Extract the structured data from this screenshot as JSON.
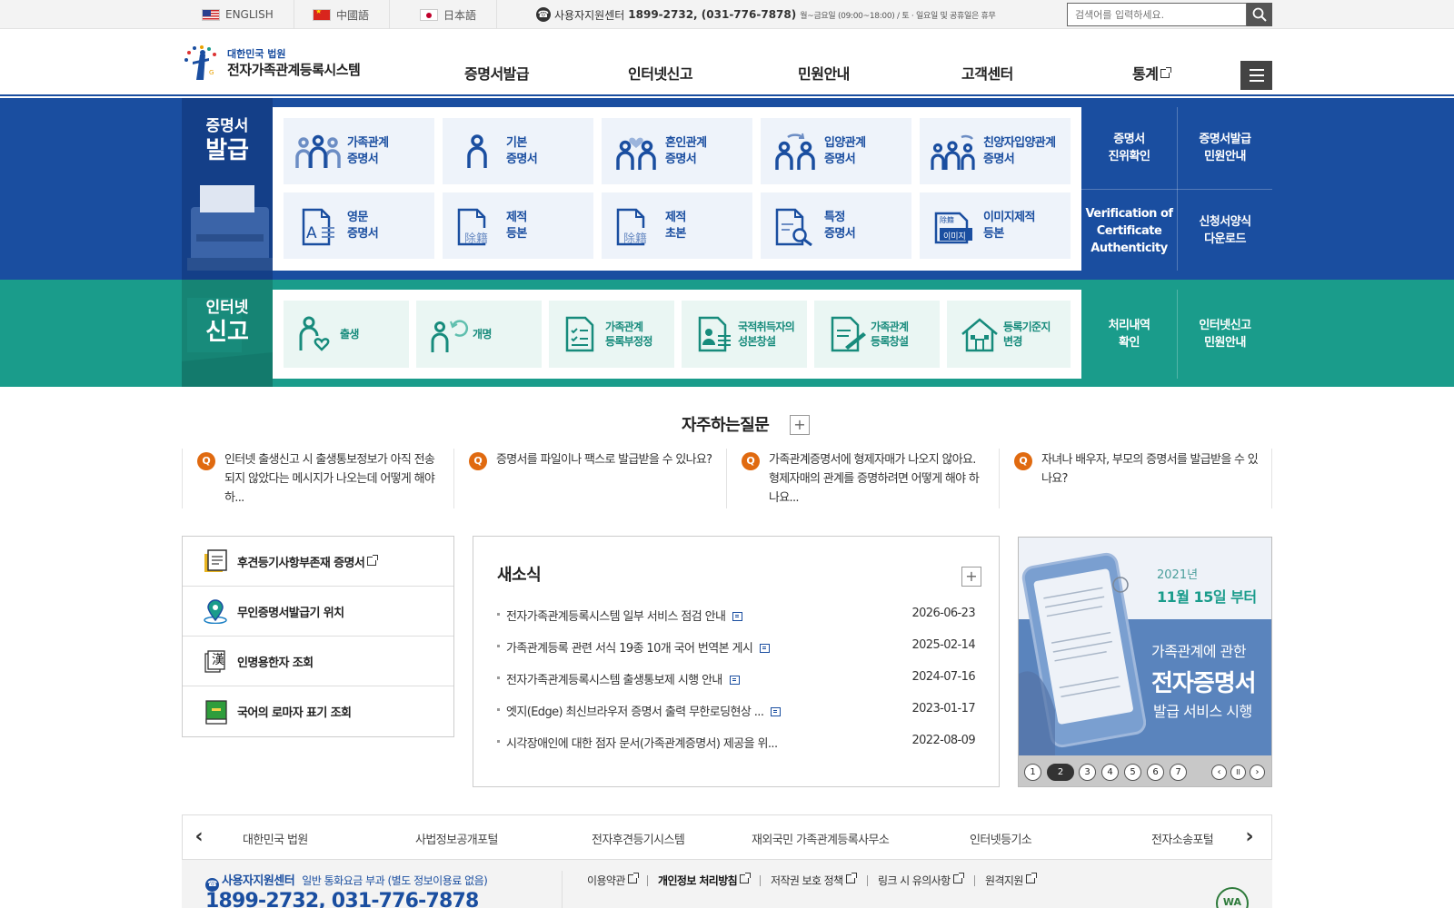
{
  "topbar": {
    "languages": [
      {
        "label": "ENGLISH",
        "flag": "us-flag-icon"
      },
      {
        "label": "中國語",
        "flag": "china-flag-icon"
      },
      {
        "label": "日本語",
        "flag": "japan-flag-icon"
      }
    ],
    "call_center_label": "사용자지원센터",
    "call_center_numbers": "1899-2732, (031-776-7878)",
    "call_center_hours": "월~금요일 (09:00~18:00) / 토 · 일요일 및 공휴일은 휴무",
    "search_placeholder": "검색어를 입력하세요."
  },
  "header": {
    "logo_org": "대한민국 법원",
    "logo_name": "전자가족관계등록시스템",
    "nav": [
      "증명서발급",
      "인터넷신고",
      "민원안내",
      "고객센터",
      "통계"
    ]
  },
  "certificates": {
    "title_small": "증명서",
    "title_big": "발급",
    "tiles": [
      {
        "line1": "가족관계",
        "line2": "증명서",
        "icon": "family-icon"
      },
      {
        "line1": "기본",
        "line2": "증명서",
        "icon": "person-icon"
      },
      {
        "line1": "혼인관계",
        "line2": "증명서",
        "icon": "marriage-icon"
      },
      {
        "line1": "입양관계",
        "line2": "증명서",
        "icon": "adoption-icon"
      },
      {
        "line1": "친양자입양관계",
        "line2": "증명서",
        "icon": "full-adoption-icon"
      },
      {
        "line1": "영문",
        "line2": "증명서",
        "icon": "english-document-icon"
      },
      {
        "line1": "제적",
        "line2": "등본",
        "icon": "removed-register-copy-icon",
        "badge": "除籍"
      },
      {
        "line1": "제적",
        "line2": "초본",
        "icon": "removed-register-abstract-icon",
        "badge": "除籍"
      },
      {
        "line1": "특정",
        "line2": "증명서",
        "icon": "document-search-icon"
      },
      {
        "line1": "이미지제적",
        "line2": "등본",
        "icon": "image-register-icon",
        "badge": "이미지",
        "badge_top": "除籍"
      }
    ],
    "side_links": [
      {
        "line1": "증명서",
        "line2": "진위확인"
      },
      {
        "line1": "증명서발급",
        "line2": "민원안내"
      },
      {
        "line1": "Verification of",
        "line2": "Certificate",
        "line3": "Authenticity"
      },
      {
        "line1": "신청서양식",
        "line2": "다운로드"
      }
    ]
  },
  "reports": {
    "title_small": "인터넷",
    "title_big": "신고",
    "tiles": [
      {
        "line1": "출생",
        "line2": "",
        "icon": "birth-icon"
      },
      {
        "line1": "개명",
        "line2": "",
        "icon": "rename-icon"
      },
      {
        "line1": "가족관계",
        "line2": "등록부정정",
        "icon": "register-correction-icon"
      },
      {
        "line1": "국적취득자의",
        "line2": "성본창설",
        "icon": "naturalization-icon"
      },
      {
        "line1": "가족관계",
        "line2": "등록창설",
        "icon": "register-creation-icon"
      },
      {
        "line1": "등록기준지",
        "line2": "변경",
        "icon": "house-icon"
      }
    ],
    "side_links": [
      {
        "line1": "처리내역",
        "line2": "확인"
      },
      {
        "line1": "인터넷신고",
        "line2": "민원안내"
      }
    ]
  },
  "faq": {
    "title": "자주하는질문",
    "more": "+",
    "badge": "Q",
    "items": [
      "인터넷 출생신고 시 출생통보정보가 아직 전송되지 않았다는 메시지가 나오는데 어떻게 해야 하...",
      "증명서를 파일이나 팩스로 발급받을 수 있나요?",
      "가족관계증명서에 형제자매가 나오지 않아요. 형제자매의 관계를 증명하려면 어떻게 해야 하나요...",
      "자녀나 배우자, 부모의 증명서를 발급받을 수 있나요?"
    ]
  },
  "quick_links": [
    {
      "label": "후견등기사항부존재 증명서",
      "icon": "guardianship-document-icon",
      "external": true
    },
    {
      "label": "무인증명서발급기 위치",
      "icon": "location-pin-icon",
      "external": false
    },
    {
      "label": "인명용한자 조회",
      "icon": "hanja-book-icon",
      "badge": "漢",
      "external": false
    },
    {
      "label": "국어의 로마자 표기 조회",
      "icon": "green-book-icon",
      "external": false
    }
  ],
  "news": {
    "title": "새소식",
    "more": "+",
    "items": [
      {
        "title": "전자가족관계등록시스템 일부 서비스 점검 안내",
        "date": "2026-06-23",
        "attachment": true
      },
      {
        "title": "가족관계등록 관련 서식 19종 10개 국어 번역본 게시",
        "date": "2025-02-14",
        "attachment": true
      },
      {
        "title": "전자가족관계등록시스템 출생통보제 시행 안내",
        "date": "2024-07-16",
        "attachment": true
      },
      {
        "title": "엣지(Edge) 최신브라우저 증명서 출력 무한로딩현상 ...",
        "date": "2023-01-17",
        "attachment": true
      },
      {
        "title": "시각장애인에 대한 점자 문서(가족관계증명서) 제공을 위...",
        "date": "2022-08-09",
        "attachment": false
      }
    ]
  },
  "banner": {
    "year": "2021년",
    "date": "11월 15일 부터",
    "line1": "가족관계에 관한",
    "line2": "전자증명서",
    "line3": "발급 서비스 시행",
    "pages": [
      "1",
      "2",
      "3",
      "4",
      "5",
      "6",
      "7"
    ],
    "active_page": 2,
    "pause_label": "II"
  },
  "related_sites": [
    "대한민국 법원",
    "사법정보공개포털",
    "전자후견등기시스템",
    "재외국민 가족관계등록사무소",
    "인터넷등기소",
    "전자소송포털"
  ],
  "footer": {
    "center_label": "사용자지원센터",
    "center_note": "일반 통화요금 부과 (별도 정보이용료 없음)",
    "phone": "1899-2732, 031-776-7878",
    "links": [
      {
        "label": "이용약관",
        "bold": false
      },
      {
        "label": "개인정보 처리방침",
        "bold": true
      },
      {
        "label": "저작권 보호 정책",
        "bold": false
      },
      {
        "label": "링크 시 유의사항",
        "bold": false
      },
      {
        "label": "원격지원",
        "bold": false
      }
    ],
    "wa_mark": "WA"
  },
  "colors": {
    "cert_blue": "#1a4ea0",
    "report_green": "#1a9c8b",
    "faq_q": "#e06a10"
  }
}
